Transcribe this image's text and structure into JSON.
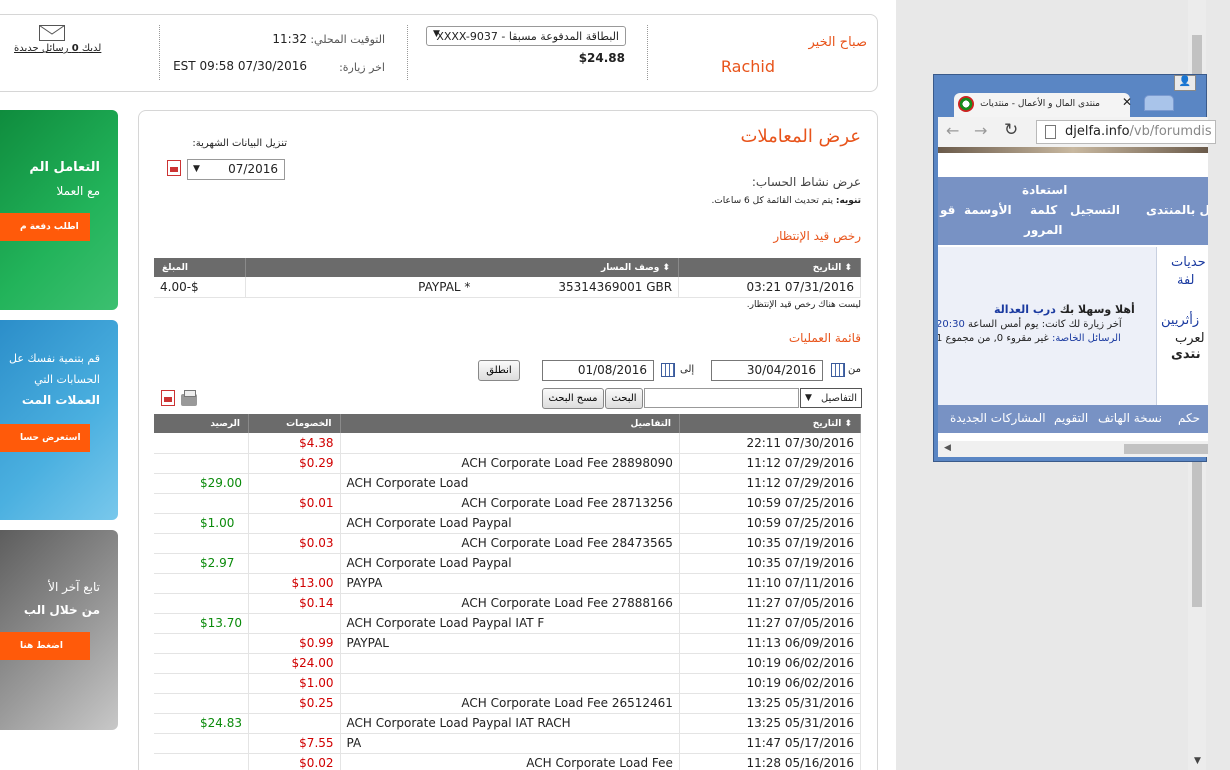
{
  "header": {
    "greeting": "صباح الخير",
    "user_name": "Rachid",
    "card_select": "البطاقة المدفوعة مسبقا - XXXX-9037",
    "balance": "$24.88",
    "local_time_label": "التوقيت المحلي:",
    "local_time": "11:32",
    "last_visit_label": "اخر زيارة:",
    "last_visit": "EST 09:58 07/30/2016",
    "messages_prefix": "لديك",
    "messages_count": "0",
    "messages_suffix": "رسائل جديدة"
  },
  "page": {
    "title": "عرض المعاملات",
    "statement_label": "تنزيل البيانات الشهرية:",
    "statement_month": "07/2016",
    "activity_label": "عرض نشاط الحساب:",
    "note_bold": "تنويه:",
    "note_text": "يتم تحديث القائمة كل 6 ساعات.",
    "pending_title": "رخص قيد الإنتظار",
    "pending_none": "ليست هناك رخص قيد الإنتظار.",
    "tx_title": "قائمة العمليات",
    "from_label": "من",
    "from_date": "30/04/2016",
    "to_label": "إلى",
    "to_date": "01/08/2016",
    "go_button": "انطلق",
    "search_field_select": "التفاصيل",
    "search_button": "البحث",
    "clear_button": "مسح البحث"
  },
  "pending": {
    "headers": [
      "التاريخ",
      "وصف المسار",
      "المبلغ"
    ],
    "rows": [
      {
        "date": "03:21 07/31/2016",
        "desc_right": "35314369001 GBR",
        "desc_left": "PAYPAL *",
        "amount": "4.00-$"
      }
    ]
  },
  "transactions": {
    "headers": [
      "التاريخ",
      "التفاصيل",
      "الخصومات",
      "الرصيد"
    ],
    "rows": [
      {
        "date": "22:11 07/30/2016",
        "detail": "",
        "debit": "$4.38",
        "credit": ""
      },
      {
        "date": "11:12 07/29/2016",
        "detail": "ACH Corporate Load Fee 28898090",
        "debit": "$0.29",
        "credit": ""
      },
      {
        "date": "11:12 07/29/2016",
        "detail": "ACH Corporate Load",
        "debit": "",
        "credit": "$29.00"
      },
      {
        "date": "10:59 07/25/2016",
        "detail": "ACH Corporate Load Fee 28713256",
        "debit": "$0.01",
        "credit": ""
      },
      {
        "date": "10:59 07/25/2016",
        "detail": "ACH Corporate Load Paypal",
        "debit": "",
        "credit": "$1.00"
      },
      {
        "date": "10:35 07/19/2016",
        "detail": "ACH Corporate Load Fee 28473565",
        "debit": "$0.03",
        "credit": ""
      },
      {
        "date": "10:35 07/19/2016",
        "detail": "ACH Corporate Load Paypal",
        "debit": "",
        "credit": "$2.97"
      },
      {
        "date": "11:10 07/11/2016",
        "detail": "PAYPA",
        "debit": "$13.00",
        "credit": ""
      },
      {
        "date": "11:27 07/05/2016",
        "detail": "ACH Corporate Load Fee 27888166",
        "debit": "$0.14",
        "credit": ""
      },
      {
        "date": "11:27 07/05/2016",
        "detail": "ACH Corporate Load Paypal IAT F",
        "debit": "",
        "credit": "$13.70"
      },
      {
        "date": "11:13 06/09/2016",
        "detail": "PAYPAL",
        "debit": "$0.99",
        "credit": ""
      },
      {
        "date": "10:19 06/02/2016",
        "detail": "",
        "debit": "$24.00",
        "credit": ""
      },
      {
        "date": "10:19 06/02/2016",
        "detail": "",
        "debit": "$1.00",
        "credit": ""
      },
      {
        "date": "13:25 05/31/2016",
        "detail": "ACH Corporate Load Fee 26512461",
        "debit": "$0.25",
        "credit": ""
      },
      {
        "date": "13:25 05/31/2016",
        "detail": "ACH Corporate Load Paypal IAT RACH",
        "debit": "",
        "credit": "$24.83"
      },
      {
        "date": "11:47 05/17/2016",
        "detail": "PA",
        "debit": "$7.55",
        "credit": ""
      },
      {
        "date": "11:28 05/16/2016",
        "detail": "ACH Corporate Load Fee",
        "debit": "$0.02",
        "credit": ""
      }
    ]
  },
  "promos": [
    {
      "line1": "التعامل الم",
      "line2": "مع العملا",
      "button": "اطلب دفعة م"
    },
    {
      "line1": "قم بتنمية نفسك عل",
      "line2": "الحسابات التي",
      "line3": "العملات المت",
      "button": "استعرض حسا"
    },
    {
      "line1": "تابع آخر الأ",
      "line2": "من خلال الب",
      "button": "اضغط هنا"
    }
  ],
  "popup": {
    "tab_title": "منتدى المال و الأعمال - منتديات",
    "url_host": "djelfa.info",
    "url_path": "/vb/forumdis",
    "nav_items": [
      "تسجيل بالمنتدى",
      "التسجيل",
      "استعادة",
      "كلمة",
      "المرور",
      "الأوسمة",
      "قو"
    ],
    "welcome": "أهلا وسهلا بك",
    "welcome_name": "درب العدالة",
    "last_visit": "آخر زيارة لك كانت: يوم أمس الساعة",
    "last_visit_time": "20:30",
    "messages": "الرسائل الخاصة:",
    "messages_detail": "غير مقروء 0, من مجموع 1",
    "side_text": [
      "حديات",
      "لفة",
      "زأثريين",
      "لعرب",
      "نتدى"
    ],
    "bar_items": [
      "حكم",
      "نسخة الهاتف",
      "التقويم",
      "المشاركات الجديدة"
    ]
  },
  "colors": {
    "accent": "#e8541b",
    "promo1": "#17a24a",
    "promo2": "#3aa0d8",
    "promo3": "#8a8a8a",
    "button": "#ff5a0a",
    "table_header": "#6b6b6b",
    "debit": "#d00000",
    "credit": "#0a8a0a"
  }
}
